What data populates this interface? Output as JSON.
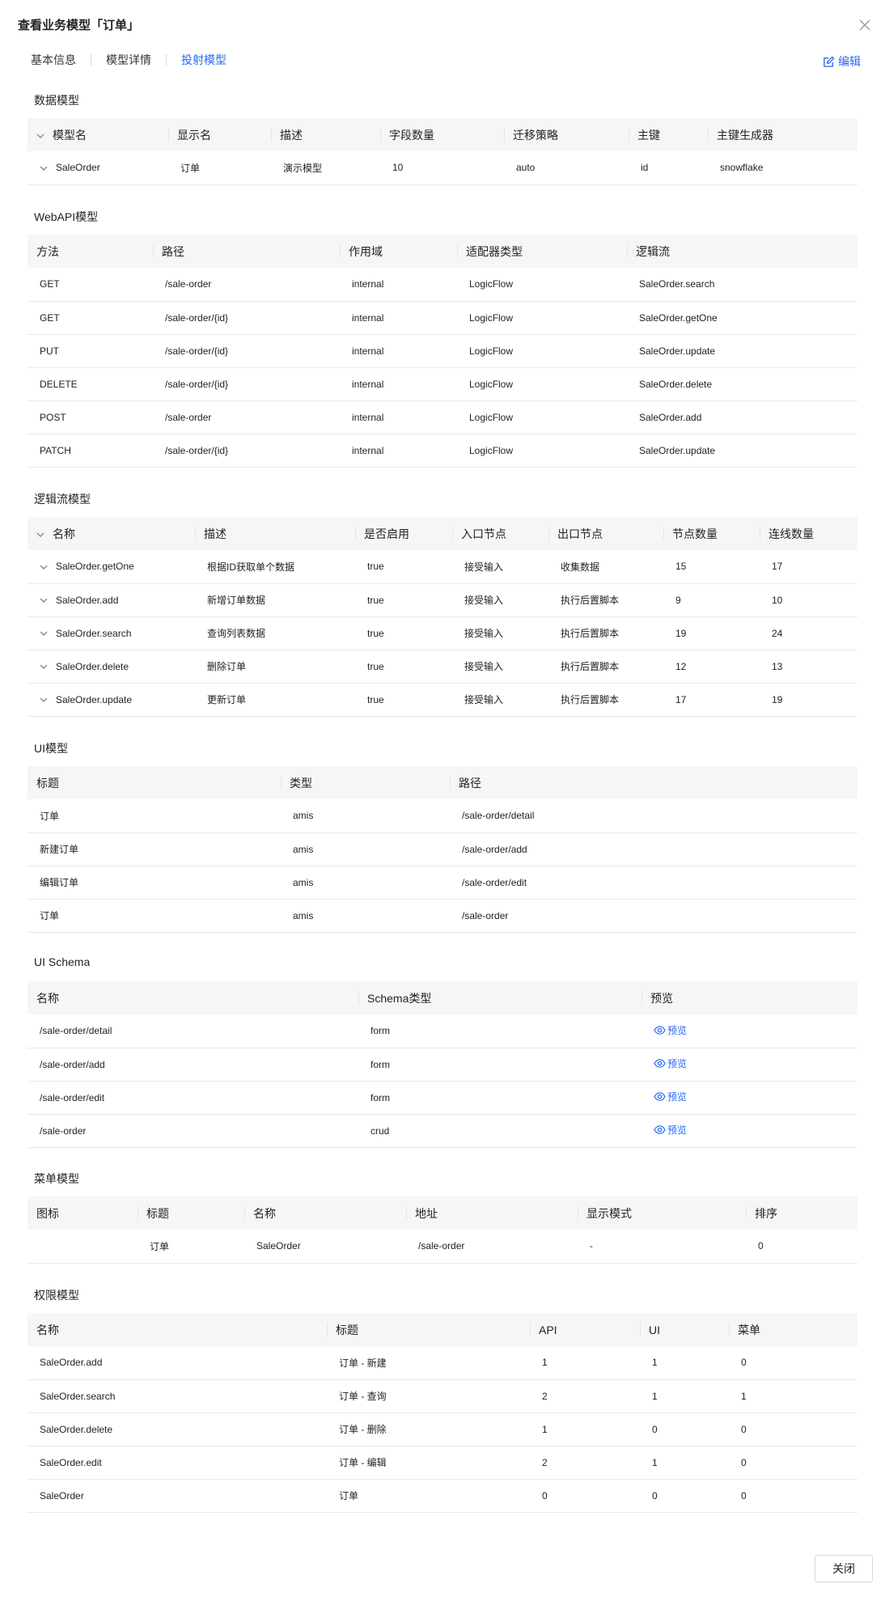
{
  "title": "查看业务模型「订单」",
  "tabs": [
    "基本信息",
    "模型详情",
    "投射模型"
  ],
  "edit_label": "编辑",
  "close_label": "关闭",
  "preview_label": "预览",
  "data_model": {
    "title": "数据模型",
    "columns": [
      "模型名",
      "显示名",
      "描述",
      "字段数量",
      "迁移策略",
      "主键",
      "主键生成器"
    ],
    "rows": [
      [
        "SaleOrder",
        "订单",
        "演示模型",
        "10",
        "auto",
        "id",
        "snowflake"
      ]
    ]
  },
  "webapi_model": {
    "title": "WebAPI模型",
    "columns": [
      "方法",
      "路径",
      "作用域",
      "适配器类型",
      "逻辑流"
    ],
    "rows": [
      [
        "GET",
        "/sale-order",
        "internal",
        "LogicFlow",
        "SaleOrder.search"
      ],
      [
        "GET",
        "/sale-order/{id}",
        "internal",
        "LogicFlow",
        "SaleOrder.getOne"
      ],
      [
        "PUT",
        "/sale-order/{id}",
        "internal",
        "LogicFlow",
        "SaleOrder.update"
      ],
      [
        "DELETE",
        "/sale-order/{id}",
        "internal",
        "LogicFlow",
        "SaleOrder.delete"
      ],
      [
        "POST",
        "/sale-order",
        "internal",
        "LogicFlow",
        "SaleOrder.add"
      ],
      [
        "PATCH",
        "/sale-order/{id}",
        "internal",
        "LogicFlow",
        "SaleOrder.update"
      ]
    ]
  },
  "logicflow_model": {
    "title": "逻辑流模型",
    "columns": [
      "名称",
      "描述",
      "是否启用",
      "入口节点",
      "出口节点",
      "节点数量",
      "连线数量"
    ],
    "rows": [
      [
        "SaleOrder.getOne",
        "根据ID获取单个数据",
        "true",
        "接受输入",
        "收集数据",
        "15",
        "17"
      ],
      [
        "SaleOrder.add",
        "新增订单数据",
        "true",
        "接受输入",
        "执行后置脚本",
        "9",
        "10"
      ],
      [
        "SaleOrder.search",
        "查询列表数据",
        "true",
        "接受输入",
        "执行后置脚本",
        "19",
        "24"
      ],
      [
        "SaleOrder.delete",
        "删除订单",
        "true",
        "接受输入",
        "执行后置脚本",
        "12",
        "13"
      ],
      [
        "SaleOrder.update",
        "更新订单",
        "true",
        "接受输入",
        "执行后置脚本",
        "17",
        "19"
      ]
    ]
  },
  "ui_model": {
    "title": "UI模型",
    "columns": [
      "标题",
      "类型",
      "路径"
    ],
    "rows": [
      [
        "订单",
        "amis",
        "/sale-order/detail"
      ],
      [
        "新建订单",
        "amis",
        "/sale-order/add"
      ],
      [
        "编辑订单",
        "amis",
        "/sale-order/edit"
      ],
      [
        "订单",
        "amis",
        "/sale-order"
      ]
    ]
  },
  "ui_schema": {
    "title": "UI Schema",
    "columns": [
      "名称",
      "Schema类型",
      "预览"
    ],
    "rows": [
      [
        "/sale-order/detail",
        "form"
      ],
      [
        "/sale-order/add",
        "form"
      ],
      [
        "/sale-order/edit",
        "form"
      ],
      [
        "/sale-order",
        "crud"
      ]
    ]
  },
  "menu_model": {
    "title": "菜单模型",
    "columns": [
      "图标",
      "标题",
      "名称",
      "地址",
      "显示模式",
      "排序"
    ],
    "rows": [
      [
        "",
        "订单",
        "SaleOrder",
        "/sale-order",
        "-",
        "0"
      ]
    ]
  },
  "permission_model": {
    "title": "权限模型",
    "columns": [
      "名称",
      "标题",
      "API",
      "UI",
      "菜单"
    ],
    "rows": [
      [
        "SaleOrder.add",
        "订单 - 新建",
        "1",
        "1",
        "0"
      ],
      [
        "SaleOrder.search",
        "订单 - 查询",
        "2",
        "1",
        "1"
      ],
      [
        "SaleOrder.delete",
        "订单 - 删除",
        "1",
        "0",
        "0"
      ],
      [
        "SaleOrder.edit",
        "订单 - 编辑",
        "2",
        "1",
        "0"
      ],
      [
        "SaleOrder",
        "订单",
        "0",
        "0",
        "0"
      ]
    ]
  },
  "colors": {
    "accent": "#2468f2",
    "header_bg": "#f5f6f8",
    "border": "#e8e9eb"
  }
}
